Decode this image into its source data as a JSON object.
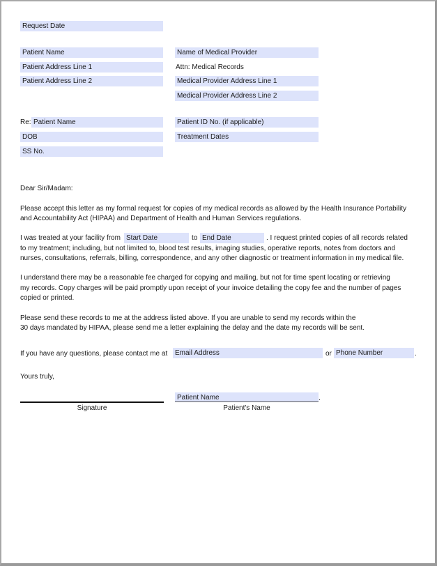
{
  "fields": {
    "request_date": "Request Date",
    "patient_name": "Patient Name",
    "patient_address_1": "Patient Address Line 1",
    "patient_address_2": "Patient Address Line 2",
    "provider_name": "Name of Medical Provider",
    "provider_address_1": "Medical Provider Address Line 1",
    "provider_address_2": "Medical Provider Address Line 2",
    "re_patient_name": "Patient Name",
    "dob": "DOB",
    "ss_no": "SS No.",
    "patient_id": "Patient ID No. (if applicable)",
    "treatment_dates": "Treatment Dates",
    "start_date": "Start Date",
    "end_date": "End Date",
    "email": "Email Address",
    "phone": "Phone Number",
    "signature_patient_name": "Patient Name"
  },
  "labels": {
    "attn": "Attn: Medical Records",
    "re": "Re:",
    "salutation": "Dear Sir/Madam:",
    "para1_line1": "Please accept this letter as my formal request for copies of my medical records as allowed by the Health Insurance Portability",
    "para1_line2": "and Accountability Act (HIPAA) and Department of Health and Human Services regulations.",
    "para2_prefix": "I was treated at your facility from",
    "para2_to": "to",
    "para2_suffix": ". I request printed copies of all records related",
    "para2_line2": "to my treatment; including, but not limited to, blood test results, imaging studies, operative reports, notes from doctors and",
    "para2_line3": "nurses, consultations, referrals, billing, correspondence, and any other diagnostic or treatment information in my medical file.",
    "para3_line1": "I understand there may be a reasonable fee charged for copying and mailing, but not for time spent locating or retrieving",
    "para3_line2": "my records. Copy charges will be paid promptly upon receipt of your invoice detailing the copy fee and the number of pages",
    "para3_line3": "copied or printed.",
    "para4_line1": "Please send these records to me at the address listed above. If you are unable to send my records within the",
    "para4_line2": "30 days mandated by HIPAA, please send me a letter explaining the delay and the date my records will be sent.",
    "contact_prefix": "If you have any questions, please contact me at",
    "contact_or": "or",
    "contact_period": ".",
    "closing": "Yours truly,",
    "signature_caption": "Signature",
    "patient_name_caption": "Patient's Name",
    "sig_period": "."
  }
}
